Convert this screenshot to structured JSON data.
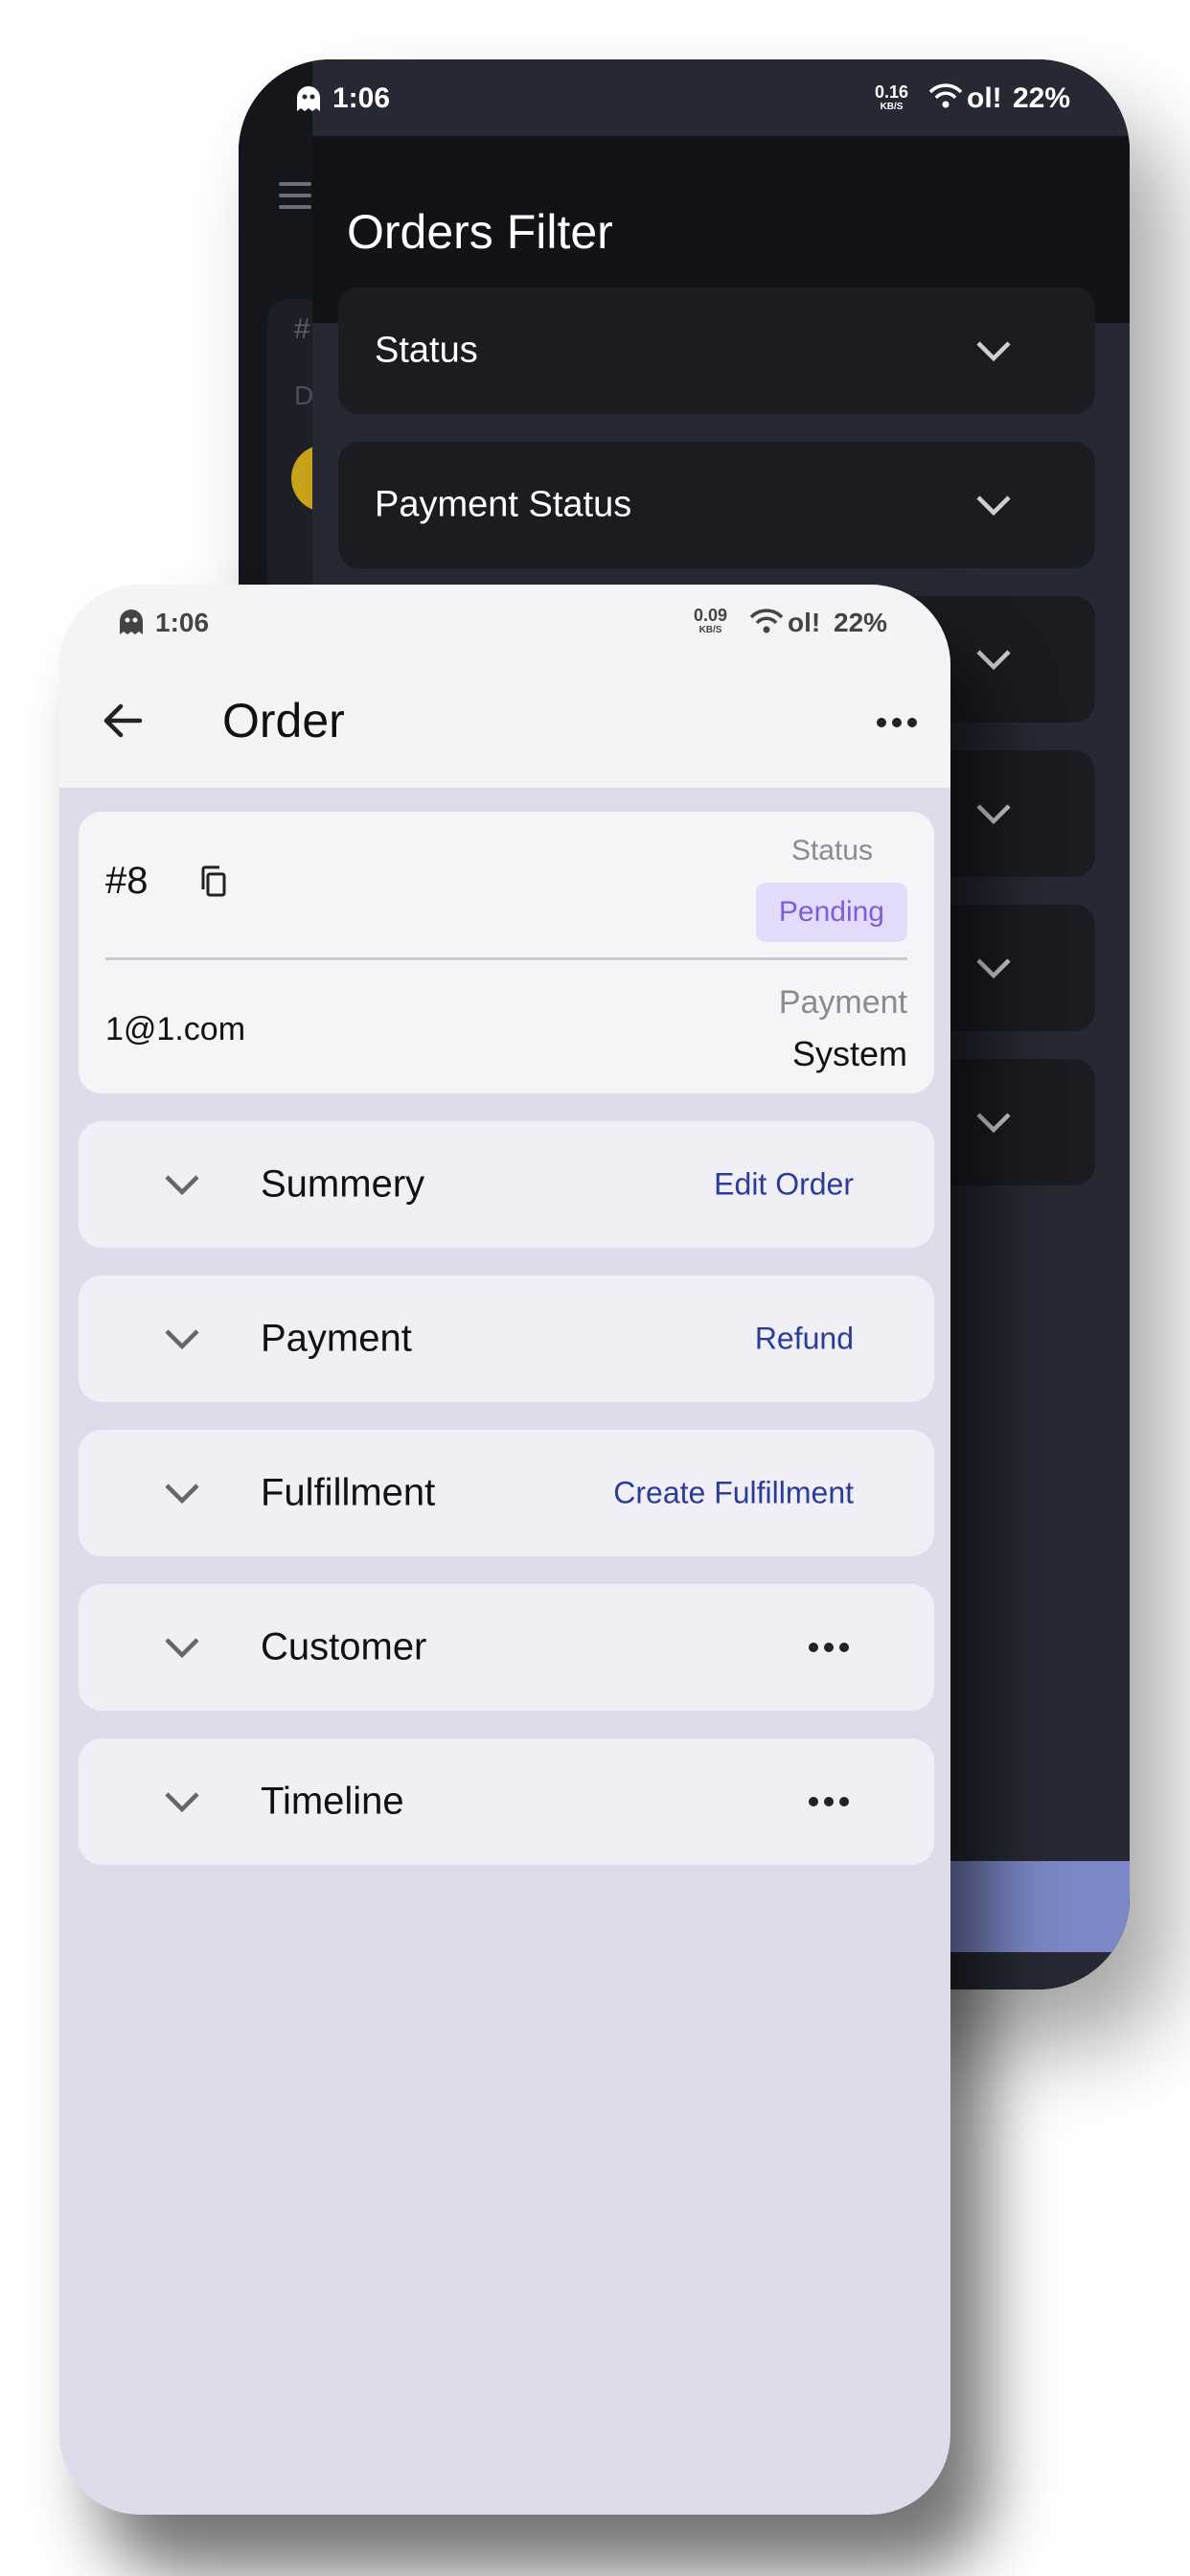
{
  "back_screen": {
    "status_bar": {
      "time": "1:06",
      "net_speed": "0.16",
      "net_unit": "KB/S",
      "signal": "ol!",
      "battery": "22%"
    },
    "title": "Orders Filter",
    "underlay": {
      "hash": "#",
      "letter": "D"
    },
    "filters": [
      {
        "label": "Status"
      },
      {
        "label": "Payment Status"
      },
      {
        "label": ""
      },
      {
        "label": ""
      },
      {
        "label": ""
      },
      {
        "label": ""
      }
    ],
    "colors": {
      "background": "#262833",
      "header": "#121317",
      "accent_button": "#7b87c6"
    }
  },
  "front_screen": {
    "status_bar": {
      "time": "1:06",
      "net_speed": "0.09",
      "net_unit": "KB/S",
      "signal": "ol!",
      "battery": "22%"
    },
    "app_bar": {
      "title": "Order"
    },
    "summary": {
      "order_number": "#8",
      "status_label": "Status",
      "status_value": "Pending",
      "email": "1@1.com",
      "payment_label": "Payment",
      "payment_value": "System"
    },
    "sections": [
      {
        "name": "Summery",
        "action": "Edit Order"
      },
      {
        "name": "Payment",
        "action": "Refund"
      },
      {
        "name": "Fulfillment",
        "action": "Create Fulfillment"
      },
      {
        "name": "Customer",
        "action": ""
      },
      {
        "name": "Timeline",
        "action": ""
      }
    ],
    "icons": {
      "back": "arrow-left-icon",
      "more": "more-horizontal-icon",
      "copy": "copy-icon",
      "expand": "chevron-down-icon"
    },
    "colors": {
      "background": "#dcdcea",
      "badge_bg": "#e2dbfa",
      "badge_text": "#7b5fd8",
      "action_text": "#2c3d99"
    }
  }
}
